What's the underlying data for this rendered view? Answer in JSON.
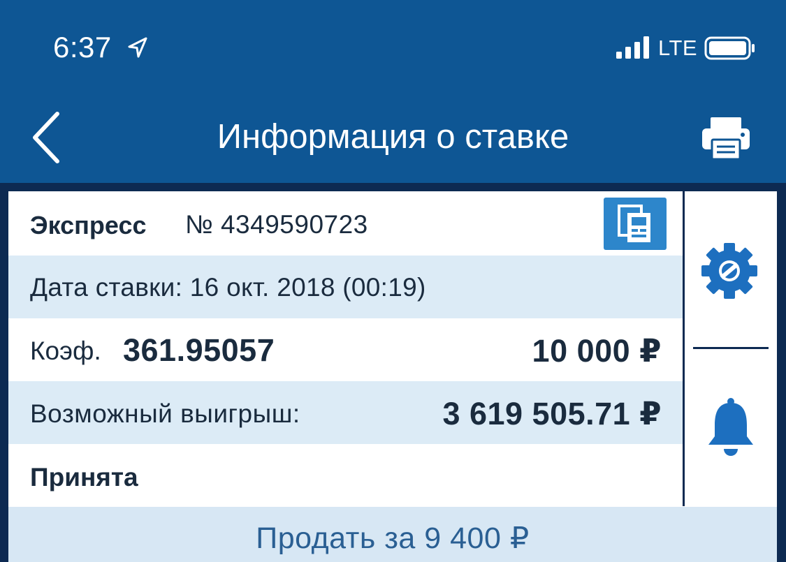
{
  "status_bar": {
    "time": "6:37",
    "network": "LTE",
    "icons": [
      "location-arrow-icon",
      "signal-bars-icon",
      "battery-icon"
    ]
  },
  "nav": {
    "title": "Информация о ставке",
    "back_icon": "chevron-left-icon",
    "print_icon": "printer-icon"
  },
  "bet": {
    "type": "Экспресс",
    "number": "№ 4349590723",
    "date": "Дата ставки: 16 окт. 2018 (00:19)",
    "coef_label": "Коэф.",
    "coef_value": "361.95057",
    "stake": "10 000 ₽",
    "win_label": "Возможный выигрыш:",
    "win_value": "3 619 505.71 ₽",
    "status": "Принята",
    "copy_icon": "copy-documents-icon"
  },
  "side_actions": {
    "settings_icon": "gear-icon",
    "notify_icon": "bell-icon"
  },
  "sell_button": {
    "label": "Продать за 9 400 ₽"
  },
  "colors": {
    "header": "#0e5694",
    "panel_bg": "#0d2a52",
    "row_alt": "#dcebf6",
    "accent": "#2d86cb",
    "sell_text": "#2a5f93"
  }
}
